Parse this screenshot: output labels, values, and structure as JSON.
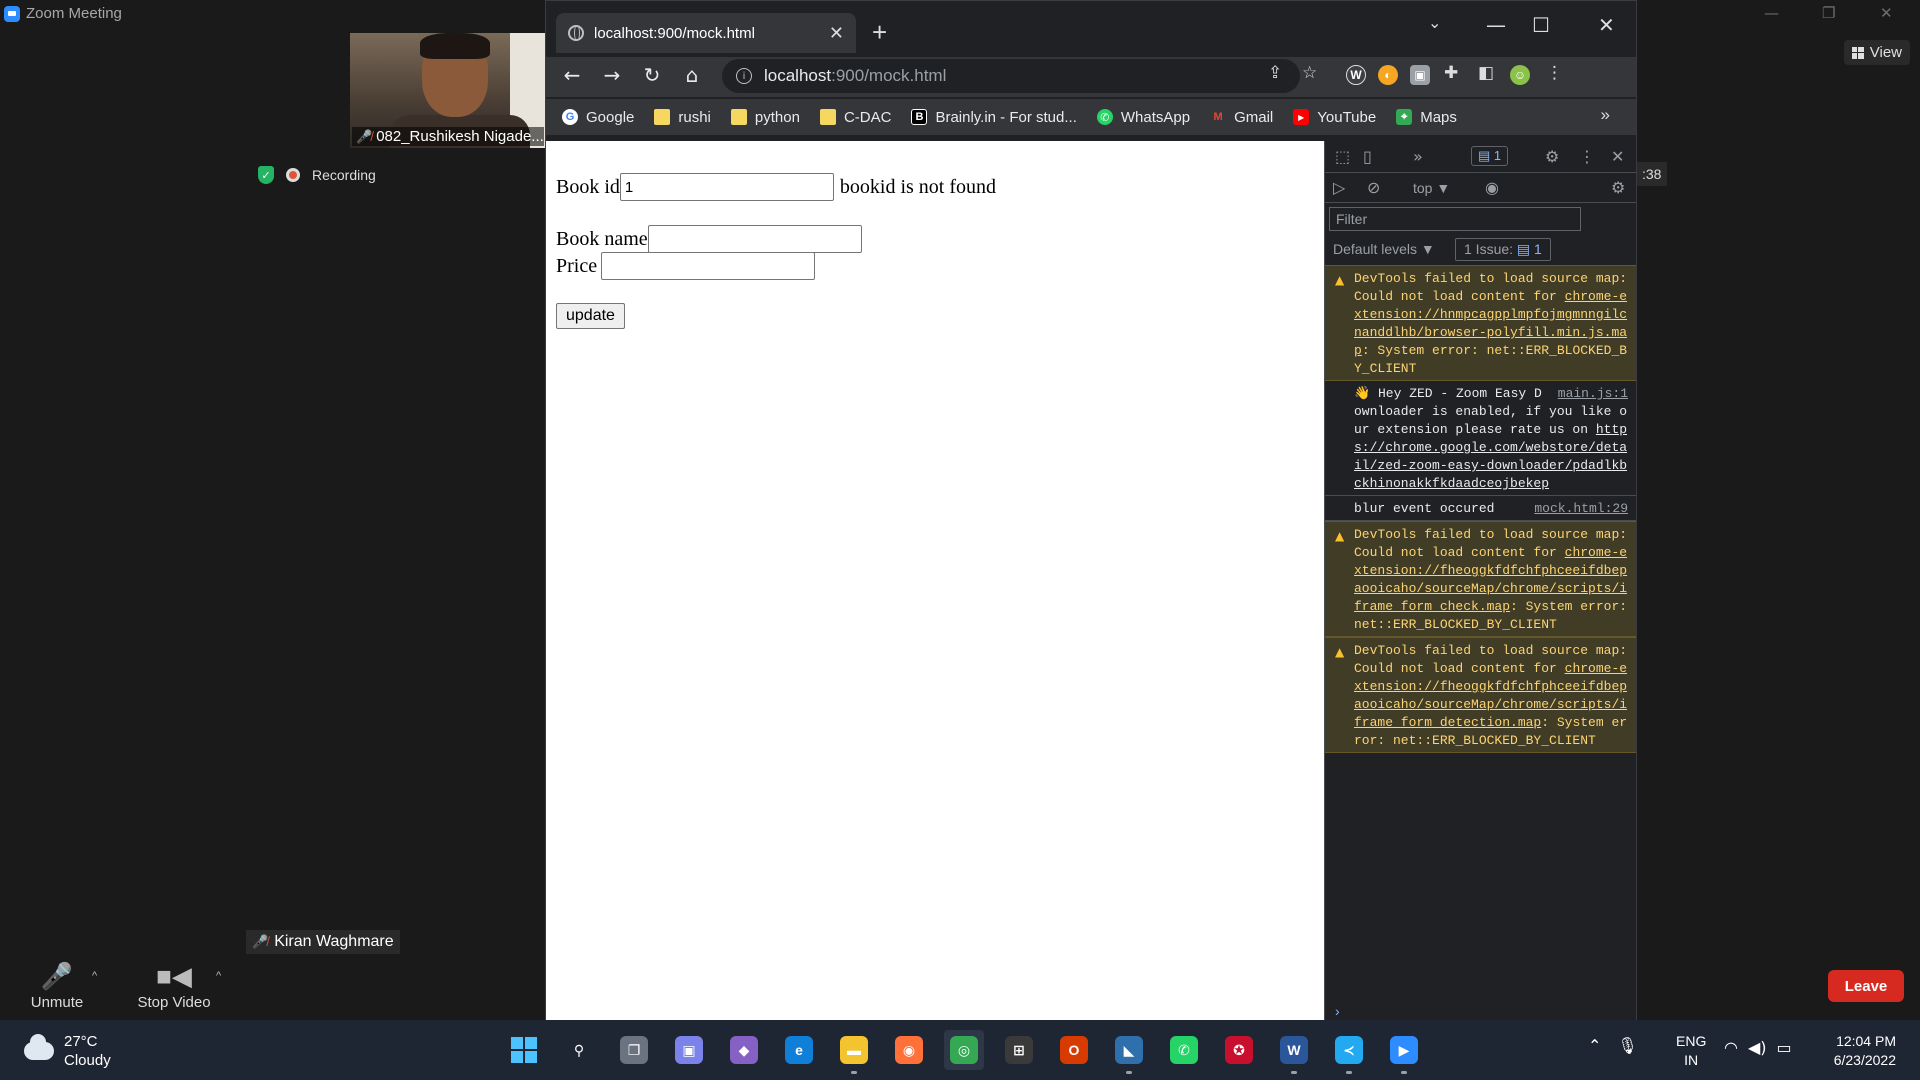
{
  "zoom": {
    "window_title": "Zoom Meeting",
    "view_label": "View",
    "participant_name": "082_Rushikesh Nigade...",
    "recording_label": "Recording",
    "other_participant": "Kiran Waghmare",
    "side_badge": ":38",
    "controls": {
      "unmute": "Unmute",
      "stop_video": "Stop Video",
      "leave": "Leave"
    }
  },
  "chrome": {
    "tab_title": "localhost:900/mock.html",
    "url_host": "localhost",
    "url_rest": ":900/mock.html",
    "bookmarks": [
      {
        "label": "Google",
        "icon": "google-icon",
        "color": "#4285f4",
        "glyph": "G"
      },
      {
        "label": "rushi",
        "icon": "folder-icon",
        "color": "#f6d860",
        "glyph": ""
      },
      {
        "label": "python",
        "icon": "folder-icon",
        "color": "#f6d860",
        "glyph": ""
      },
      {
        "label": "C-DAC",
        "icon": "folder-icon",
        "color": "#f6d860",
        "glyph": ""
      },
      {
        "label": "Brainly.in - For stud...",
        "icon": "brainly-icon",
        "color": "#000000",
        "glyph": "B"
      },
      {
        "label": "WhatsApp",
        "icon": "whatsapp-icon",
        "color": "#25d366",
        "glyph": "✆"
      },
      {
        "label": "Gmail",
        "icon": "gmail-icon",
        "color": "#ea4335",
        "glyph": "M"
      },
      {
        "label": "YouTube",
        "icon": "youtube-icon",
        "color": "#ff0000",
        "glyph": "▶"
      },
      {
        "label": "Maps",
        "icon": "maps-icon",
        "color": "#34a853",
        "glyph": "⌖"
      }
    ],
    "bookmarks_more": "»"
  },
  "page": {
    "book_id_label": "Book id",
    "book_id_value": "1",
    "not_found_msg": "bookid is not found",
    "book_name_label": "Book name",
    "book_name_value": "",
    "price_label": "Price",
    "price_value": "",
    "update_label": "update"
  },
  "devtools": {
    "issues_count": "1",
    "context": "top",
    "filter_placeholder": "Filter",
    "default_levels": "Default levels",
    "issue_chip_label": "1 Issue:",
    "issue_chip_count": "1",
    "messages": [
      {
        "type": "warn",
        "prefix": "DevTools failed to load source map: Could not load content for ",
        "link": "chrome-extension://hnmpcagpplmpfojmgmnngilcnanddlhb/browser-polyfill.min.js.map",
        "suffix": ": System error: net::ERR_BLOCKED_BY_CLIENT",
        "source": ""
      },
      {
        "type": "log",
        "prefix": "👋 Hey ZED - Zoom Easy Downloader is enabled, if you like our extension please rate us on ",
        "link": "https://chrome.google.com/webstore/detail/zed-zoom-easy-downloader/pdadlkbckhinonakkfkdaadceojbekep",
        "suffix": "",
        "source": "main.js:1"
      },
      {
        "type": "log",
        "prefix": "blur event occured",
        "link": "",
        "suffix": "",
        "source": "mock.html:29"
      },
      {
        "type": "warn",
        "prefix": "DevTools failed to load source map: Could not load content for ",
        "link": "chrome-extension://fheoggkfdfchfphceeifdbepaooicaho/sourceMap/chrome/scripts/iframe_form_check.map",
        "suffix": ": System error: net::ERR_BLOCKED_BY_CLIENT",
        "source": ""
      },
      {
        "type": "warn",
        "prefix": "DevTools failed to load source map: Could not load content for ",
        "link": "chrome-extension://fheoggkfdfchfphceeifdbepaooicaho/sourceMap/chrome/scripts/iframe_form_detection.map",
        "suffix": ": System error: net::ERR_BLOCKED_BY_CLIENT",
        "source": ""
      }
    ]
  },
  "taskbar": {
    "temperature": "27°C",
    "weather": "Cloudy",
    "lang_line1": "ENG",
    "lang_line2": "IN",
    "time": "12:04 PM",
    "date": "6/23/2022",
    "apps": [
      {
        "name": "start-button",
        "color": "#4cc2ff",
        "glyph": "",
        "state": ""
      },
      {
        "name": "search-button",
        "color": "#1f2633",
        "glyph": "⚲",
        "state": ""
      },
      {
        "name": "task-view-button",
        "color": "#6b7280",
        "glyph": "❐",
        "state": ""
      },
      {
        "name": "teams-chat-app",
        "color": "#7b83eb",
        "glyph": "▣",
        "state": ""
      },
      {
        "name": "visual-studio-app",
        "color": "#8661c5",
        "glyph": "◆",
        "state": ""
      },
      {
        "name": "edge-app",
        "color": "#0f7fd8",
        "glyph": "e",
        "state": ""
      },
      {
        "name": "file-explorer-app",
        "color": "#f4c430",
        "glyph": "▬",
        "state": "running"
      },
      {
        "name": "firefox-app",
        "color": "#ff7139",
        "glyph": "◉",
        "state": ""
      },
      {
        "name": "chrome-app",
        "color": "#34a853",
        "glyph": "◎",
        "state": "active"
      },
      {
        "name": "store-app",
        "color": "#3a3a3a",
        "glyph": "⊞",
        "state": ""
      },
      {
        "name": "office-app",
        "color": "#d83b01",
        "glyph": "O",
        "state": ""
      },
      {
        "name": "sql-app",
        "color": "#2f6fab",
        "glyph": "◣",
        "state": "running"
      },
      {
        "name": "whatsapp-app",
        "color": "#25d366",
        "glyph": "✆",
        "state": ""
      },
      {
        "name": "antivirus-app",
        "color": "#c8102e",
        "glyph": "✪",
        "state": ""
      },
      {
        "name": "word-app",
        "color": "#2b579a",
        "glyph": "W",
        "state": "running"
      },
      {
        "name": "vscode-app",
        "color": "#23a9f2",
        "glyph": "≺",
        "state": "running"
      },
      {
        "name": "zoom-app",
        "color": "#2d8cff",
        "glyph": "▶",
        "state": "running"
      }
    ]
  }
}
